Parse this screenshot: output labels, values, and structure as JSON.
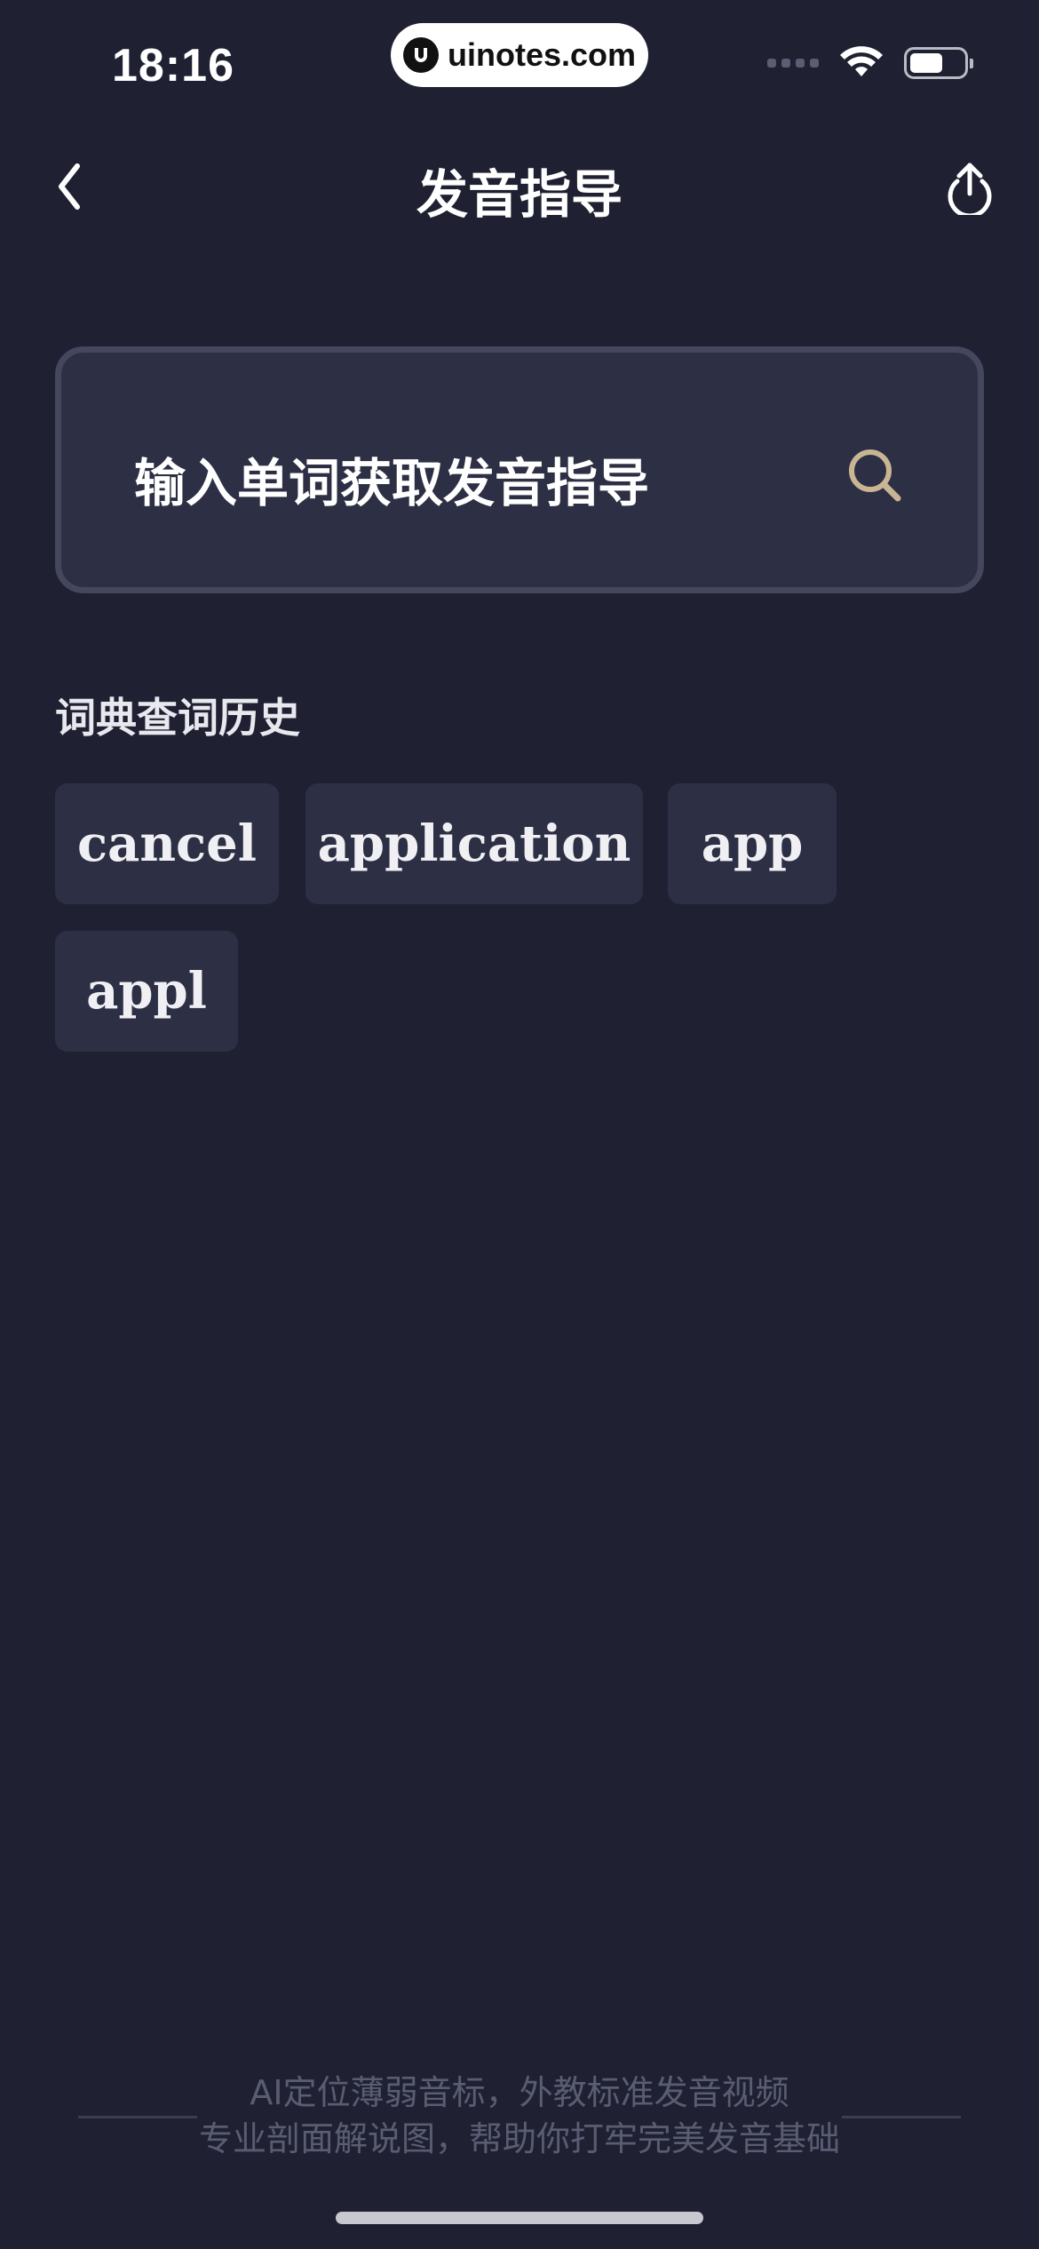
{
  "status_bar": {
    "time": "18:16",
    "watermark": "uinotes.com",
    "battery_level_fraction": 0.62
  },
  "nav": {
    "title": "发音指导"
  },
  "search": {
    "placeholder": "输入单词获取发音指导"
  },
  "history": {
    "title": "词典查词历史",
    "items": [
      "cancel",
      "application",
      "app",
      "appl"
    ]
  },
  "footer": {
    "line1": "AI定位薄弱音标，外教标准发音视频",
    "line2": "专业剖面解说图，帮助你打牢完美发音基础"
  },
  "colors": {
    "background": "#1f2133",
    "card": "#2d3044",
    "search_accent": "#c9b593"
  }
}
